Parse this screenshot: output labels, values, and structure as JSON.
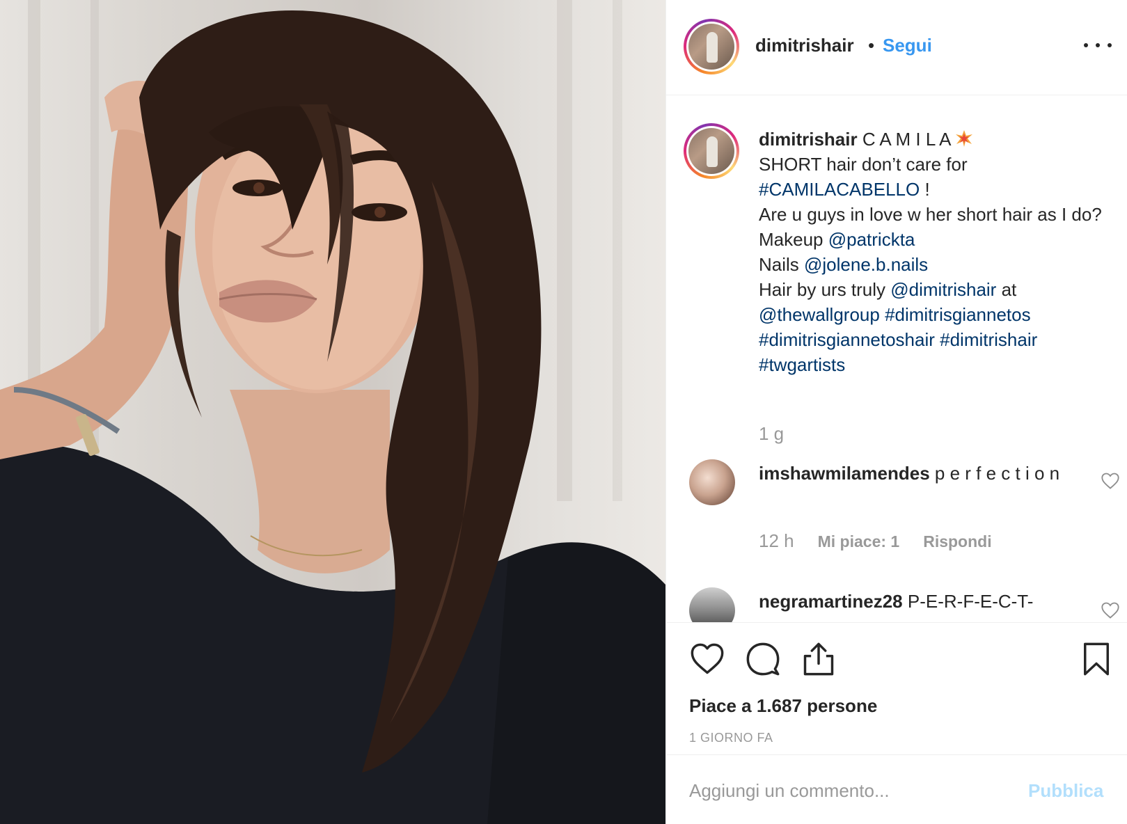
{
  "post": {
    "author": "dimitrishair",
    "separator": "•",
    "follow_label": "Segui",
    "more_icon": "more-options-icon"
  },
  "caption": {
    "username": "dimitrishair",
    "title": "C A M I L A",
    "line_2": "SHORT hair don’t care for",
    "hashtag_camila": "#CAMILACABELLO",
    "exclaim": " !",
    "line_4": "Are u guys in love w her short hair as I do?",
    "makeup_label": "Makeup ",
    "makeup_handle": "@patrickta",
    "nails_label": "Nails ",
    "nails_handle": "@jolene.b.nails",
    "hair_label": "Hair by urs truly ",
    "hair_handle": "@dimitrishair",
    "at_word": " at",
    "wallgroup": "@thewallgroup",
    "tag_1": "#dimitrisgiannetos",
    "tag_2": "#dimitrisgiannetoshair",
    "tag_3": "#dimitrishair",
    "tag_4": "#twgartists",
    "age": "1 g"
  },
  "comments": [
    {
      "username": "imshawmilamendes",
      "text": "p e r f e c t i o n",
      "age": "12 h",
      "likes": "Mi piace: 1",
      "reply": "Rispondi"
    },
    {
      "username": "negramartinez28",
      "text": "P-E-R-F-E-C-T-"
    }
  ],
  "actions": {
    "likes_text": "Piace a 1.687 persone",
    "date_text": "1 GIORNO FA"
  },
  "add_comment": {
    "placeholder": "Aggiungi un commento...",
    "publish_label": "Pubblica"
  },
  "colors": {
    "link": "#003569",
    "follow": "#3897f0",
    "muted": "#999999",
    "publish_disabled": "#b2dffc"
  }
}
